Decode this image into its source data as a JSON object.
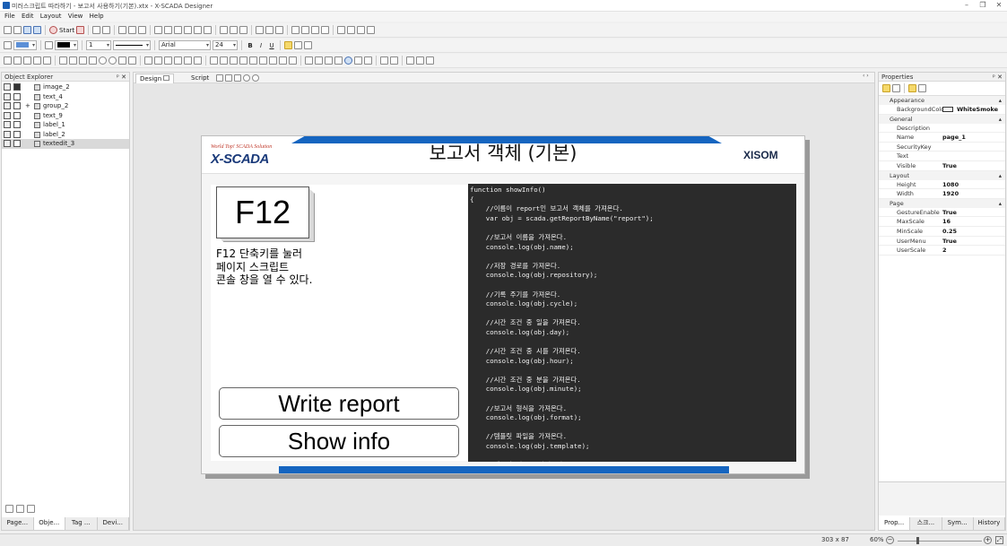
{
  "window": {
    "title": "미러스크립트 따라하기 - 보고서 사용하기(기본).xtx - X-SCADA Designer"
  },
  "menu": [
    "File",
    "Edit",
    "Layout",
    "View",
    "Help"
  ],
  "toolbar": {
    "start_label": "Start",
    "font_name": "Arial",
    "font_size": "24",
    "line_width": "1"
  },
  "object_explorer": {
    "title": "Object Explorer",
    "items": [
      {
        "name": "image_2"
      },
      {
        "name": "text_4"
      },
      {
        "name": "group_2"
      },
      {
        "name": "text_9"
      },
      {
        "name": "label_1"
      },
      {
        "name": "label_2"
      },
      {
        "name": "textedit_3"
      }
    ],
    "tabs": [
      "Page...",
      "Obje...",
      "Tag ...",
      "Devi..."
    ]
  },
  "editor_tabs": {
    "design": "Design",
    "script": "Script"
  },
  "page": {
    "brand_tagline": "World Top! SCADA Solution",
    "brand": "X-SCADA",
    "title": "보고서 객체 (기본)",
    "partner_logo": "XISOM",
    "key_label": "F12",
    "description": "F12 단축키를 눌러\n페이지 스크립트\n콘솔 창을 열 수 있다.",
    "button_write": "Write report",
    "button_show": "Show info",
    "code": "function showInfo()\n{\n    //이름이 report인 보고서 객체를 가져온다.\n    var obj = scada.getReportByName(\"report\");\n\n    //보고서 이름을 가져온다.\n    console.log(obj.name);\n\n    //저장 경로를 가져온다.\n    console.log(obj.repository);\n\n    //기록 주기를 가져온다.\n    console.log(obj.cycle);\n\n    //시간 조건 중 일을 가져온다.\n    console.log(obj.day);\n\n    //시간 조건 중 시를 가져온다.\n    console.log(obj.hour);\n\n    //시간 조건 중 분을 가져온다.\n    console.log(obj.minute);\n\n    //보고서 형식을 가져온다.\n    console.log(obj.format);\n\n    //템플릿 파일을 가져온다.\n    console.log(obj.template);\n\n    //템플릿 이름을 가져온다."
  },
  "properties": {
    "title": "Properties",
    "categories": [
      {
        "name": "Appearance",
        "rows": [
          {
            "key": "BackgroundColo",
            "value": "WhiteSmoke"
          }
        ]
      },
      {
        "name": "General",
        "rows": [
          {
            "key": "Description",
            "value": ""
          },
          {
            "key": "Name",
            "value": "page_1"
          },
          {
            "key": "SecurityKey",
            "value": ""
          },
          {
            "key": "Text",
            "value": ""
          },
          {
            "key": "Visible",
            "value": "True"
          }
        ]
      },
      {
        "name": "Layout",
        "rows": [
          {
            "key": "Height",
            "value": "1080"
          },
          {
            "key": "Width",
            "value": "1920"
          }
        ]
      },
      {
        "name": "Page",
        "rows": [
          {
            "key": "GestureEnable",
            "value": "True"
          },
          {
            "key": "MaxScale",
            "value": "16"
          },
          {
            "key": "MinScale",
            "value": "0.25"
          },
          {
            "key": "UserMenu",
            "value": "True"
          },
          {
            "key": "UserScale",
            "value": "2"
          }
        ]
      }
    ],
    "tabs": [
      "Prop...",
      "스크...",
      "Sym...",
      "History"
    ]
  },
  "status": {
    "coords": "303 x 87",
    "zoom": "60%"
  },
  "colors": {
    "accent_blue": "#1565c0",
    "code_bg": "#2b2b2b",
    "selection": "#f5d96b"
  }
}
